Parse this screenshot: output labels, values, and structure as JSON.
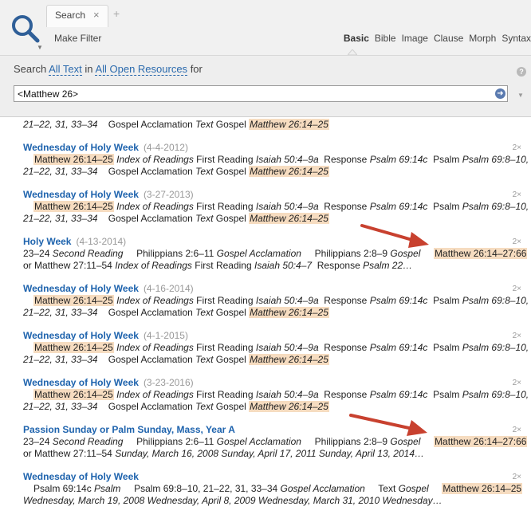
{
  "tabs": [
    {
      "label": "Search",
      "close": "×"
    }
  ],
  "add_tab": "+",
  "toolbar": {
    "make_filter": "Make Filter",
    "modes": [
      "Basic",
      "Bible",
      "Image",
      "Clause",
      "Morph",
      "Syntax"
    ]
  },
  "scope": {
    "prefix": "Search",
    "all_text": "All Text",
    "in": "in",
    "resources": "All Open Resources",
    "for": "for"
  },
  "search": {
    "value": "<Matthew 26>",
    "help": "?"
  },
  "results": [
    {
      "lines": [
        [
          "21–22, 31, 33–34",
          "Gospel Acclamation",
          "Text",
          "Gospel",
          "Matthew 26:14–25"
        ]
      ]
    },
    {
      "title": "Wednesday of Holy Week",
      "date": "(4-4-2012)",
      "count": "2×",
      "l1": [
        "Matthew 26:14–25",
        "Index of Readings",
        "First Reading",
        "Isaiah 50:4–9a",
        "Response",
        "Psalm 69:14c",
        "Psalm",
        "Psalm 69:8–10,"
      ],
      "l2": [
        "21–22, 31, 33–34",
        "Gospel Acclamation",
        "Text",
        "Gospel",
        "Matthew 26:14–25"
      ]
    },
    {
      "title": "Wednesday of Holy Week",
      "date": "(3-27-2013)",
      "count": "2×",
      "l1": [
        "Matthew 26:14–25",
        "Index of Readings",
        "First Reading",
        "Isaiah 50:4–9a",
        "Response",
        "Psalm 69:14c",
        "Psalm",
        "Psalm 69:8–10,"
      ],
      "l2": [
        "21–22, 31, 33–34",
        "Gospel Acclamation",
        "Text",
        "Gospel",
        "Matthew 26:14–25"
      ]
    },
    {
      "title": "Holy Week",
      "date": "(4-13-2014)",
      "count": "2×",
      "l1": [
        "23–24",
        "Second Reading",
        "Philippians 2:6–11",
        "Gospel Acclamation",
        "Philippians 2:8–9",
        "Gospel",
        "Matthew 26:14–27:66"
      ],
      "l2": [
        "or Matthew 27:11–54",
        "Index of Readings",
        "First Reading",
        "Isaiah 50:4–7",
        "Response",
        "Psalm 22…"
      ]
    },
    {
      "title": "Wednesday of Holy Week",
      "date": "(4-16-2014)",
      "count": "2×",
      "l1": [
        "Matthew 26:14–25",
        "Index of Readings",
        "First Reading",
        "Isaiah 50:4–9a",
        "Response",
        "Psalm 69:14c",
        "Psalm",
        "Psalm 69:8–10,"
      ],
      "l2": [
        "21–22, 31, 33–34",
        "Gospel Acclamation",
        "Text",
        "Gospel",
        "Matthew 26:14–25"
      ]
    },
    {
      "title": "Wednesday of Holy Week",
      "date": "(4-1-2015)",
      "count": "2×",
      "l1": [
        "Matthew 26:14–25",
        "Index of Readings",
        "First Reading",
        "Isaiah 50:4–9a",
        "Response",
        "Psalm 69:14c",
        "Psalm",
        "Psalm 69:8–10,"
      ],
      "l2": [
        "21–22, 31, 33–34",
        "Gospel Acclamation",
        "Text",
        "Gospel",
        "Matthew 26:14–25"
      ]
    },
    {
      "title": "Wednesday of Holy Week",
      "date": "(3-23-2016)",
      "count": "2×",
      "l1": [
        "Matthew 26:14–25",
        "Index of Readings",
        "First Reading",
        "Isaiah 50:4–9a",
        "Response",
        "Psalm 69:14c",
        "Psalm",
        "Psalm 69:8–10,"
      ],
      "l2": [
        "21–22, 31, 33–34",
        "Gospel Acclamation",
        "Text",
        "Gospel",
        "Matthew 26:14–25"
      ]
    },
    {
      "title": "Passion Sunday or Palm Sunday, Mass, Year A",
      "count": "2×",
      "l1": [
        "23–24",
        "Second Reading",
        "Philippians 2:6–11",
        "Gospel Acclamation",
        "Philippians 2:8–9",
        "Gospel",
        "Matthew 26:14–27:66"
      ],
      "l2": [
        "or Matthew 27:11–54",
        "Sunday, March 16, 2008 Sunday, April 17, 2011 Sunday, April 13, 2014…"
      ]
    },
    {
      "title": "Wednesday of Holy Week",
      "count": "2×",
      "l1": [
        "Psalm 69:14c",
        "Psalm",
        "Psalm 69:8–10, 21–22, 31, 33–34",
        "Gospel Acclamation",
        "Text",
        "Gospel",
        "Matthew 26:14–25"
      ],
      "l2": [
        "Wednesday, March 19, 2008 Wednesday, April 8, 2009 Wednesday, March 31, 2010 Wednesday…"
      ]
    }
  ],
  "colors": {
    "link": "#1e63ad",
    "highlight": "#f6dcc0",
    "arrow": "#c8412f"
  }
}
